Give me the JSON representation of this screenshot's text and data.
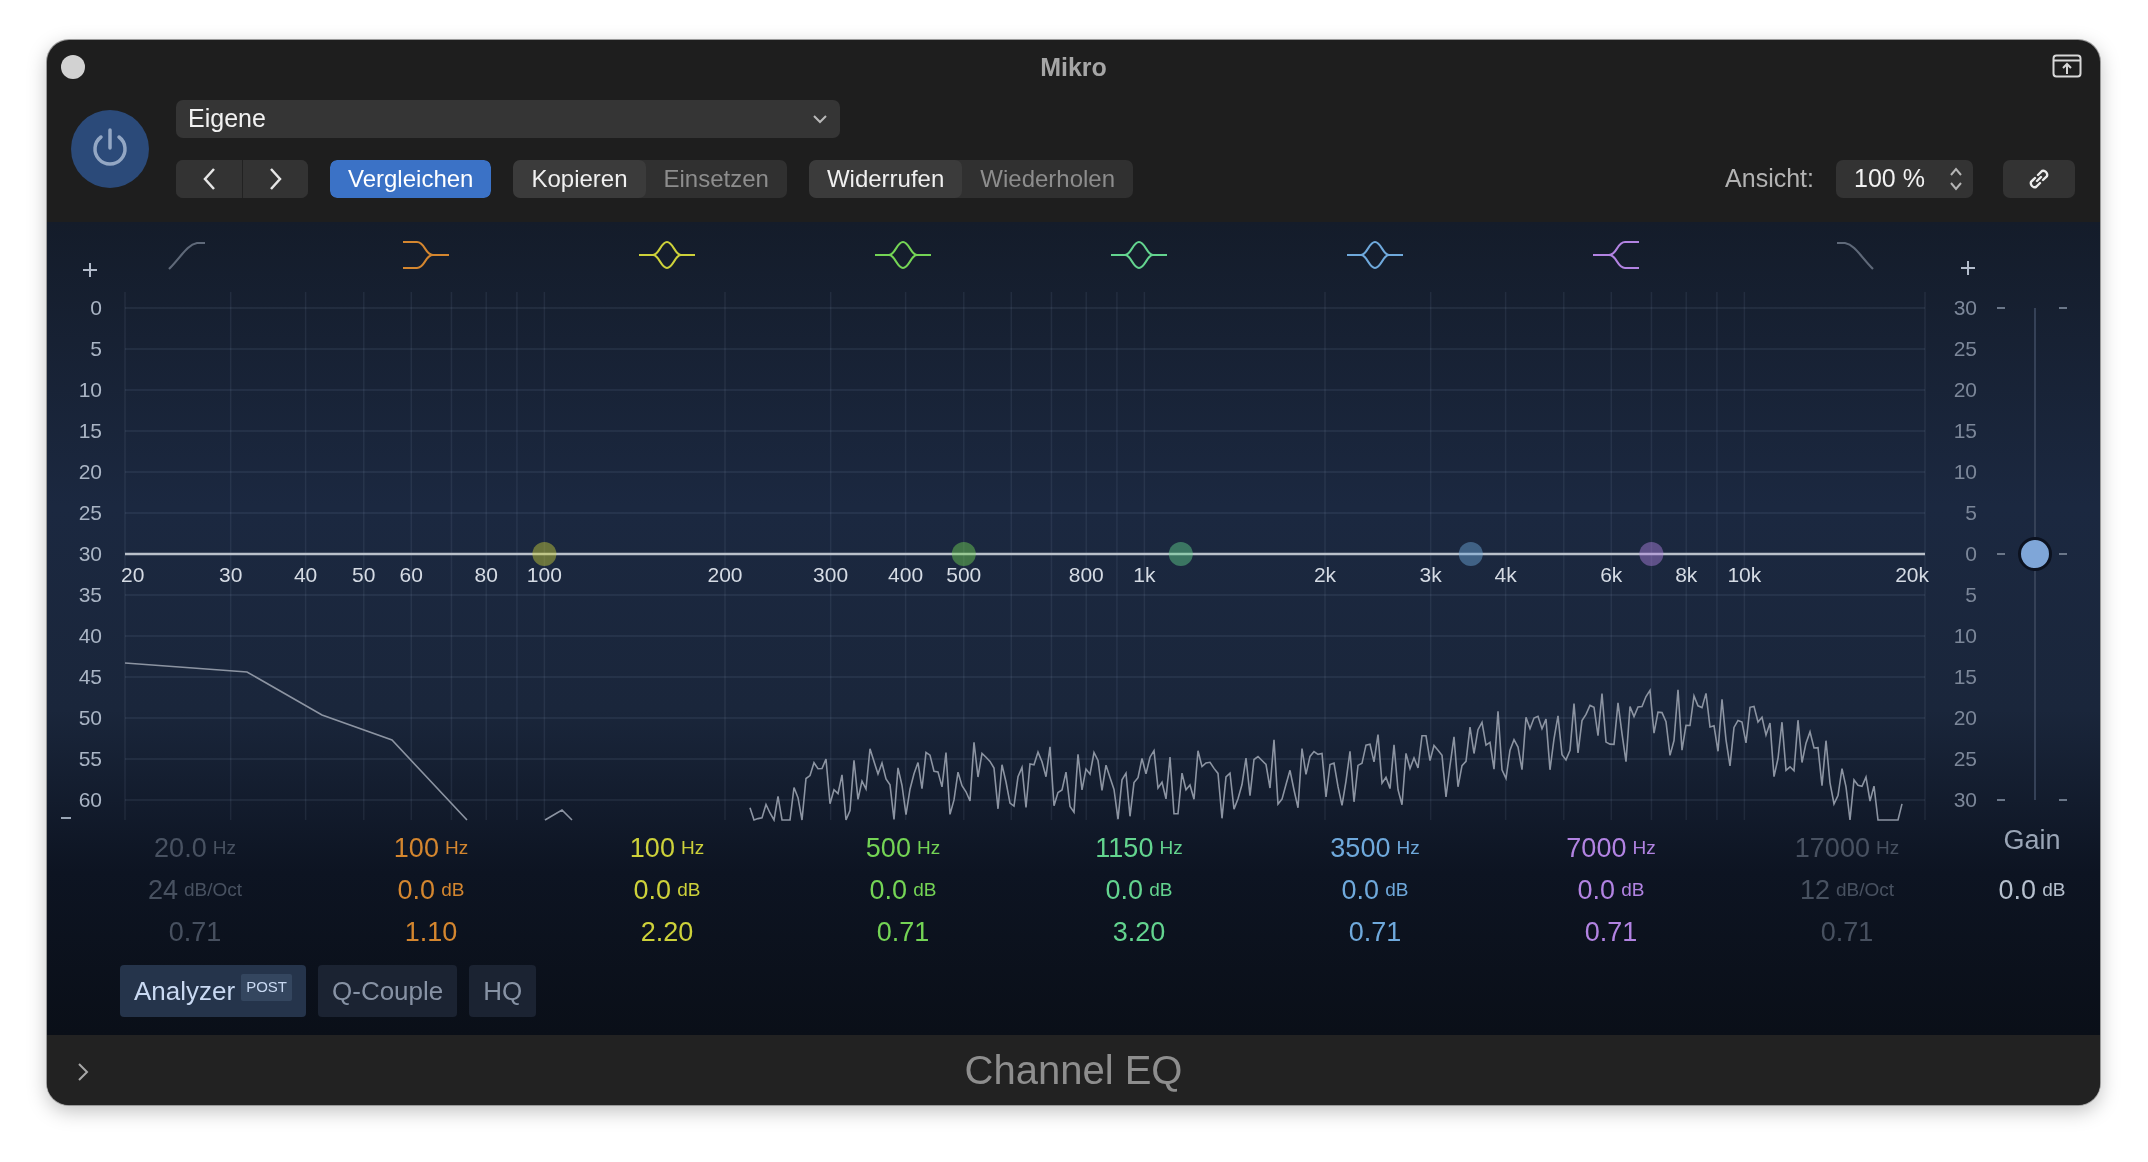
{
  "window": {
    "title": "Mikro"
  },
  "power": {
    "on": true
  },
  "preset": {
    "value": "Eigene"
  },
  "toolbar_groups": [
    {
      "buttons": [
        {
          "label": "Vergleichen",
          "selected": true,
          "disabled": false
        }
      ]
    },
    {
      "buttons": [
        {
          "label": "Kopieren",
          "selected": false,
          "disabled": false
        },
        {
          "label": "Einsetzen",
          "selected": false,
          "disabled": true
        }
      ]
    },
    {
      "buttons": [
        {
          "label": "Widerrufen",
          "selected": false,
          "disabled": false
        },
        {
          "label": "Wiederholen",
          "selected": false,
          "disabled": true
        }
      ]
    }
  ],
  "view": {
    "label": "Ansicht:",
    "value": "100 %"
  },
  "analyzer_axis": [
    "0",
    "5",
    "10",
    "15",
    "20",
    "25",
    "30",
    "35",
    "40",
    "45",
    "50",
    "55",
    "60"
  ],
  "gain_axis": [
    "30",
    "25",
    "20",
    "15",
    "10",
    "5",
    "0",
    "5",
    "10",
    "15",
    "20",
    "25",
    "30"
  ],
  "freq_axis": [
    "20",
    "30",
    "40",
    "50",
    "60",
    "80",
    "100",
    "200",
    "300",
    "400",
    "500",
    "800",
    "1k",
    "2k",
    "3k",
    "4k",
    "6k",
    "8k",
    "10k",
    "20k"
  ],
  "bands": [
    {
      "kind": "low_cut",
      "enabled": false,
      "color": "#5f6979",
      "freq": "20.0",
      "freq_unit": "Hz",
      "gain": "24",
      "gain_unit": "dB/Oct",
      "q": "0.71"
    },
    {
      "kind": "low_shelf",
      "enabled": true,
      "color": "#d4862f",
      "freq": "100",
      "freq_unit": "Hz",
      "gain": "0.0",
      "gain_unit": "dB",
      "q": "1.10"
    },
    {
      "kind": "bell",
      "enabled": true,
      "color": "#cdd13a",
      "freq": "100",
      "freq_unit": "Hz",
      "gain": "0.0",
      "gain_unit": "dB",
      "q": "2.20"
    },
    {
      "kind": "bell",
      "enabled": true,
      "color": "#74d455",
      "freq": "500",
      "freq_unit": "Hz",
      "gain": "0.0",
      "gain_unit": "dB",
      "q": "0.71"
    },
    {
      "kind": "bell",
      "enabled": true,
      "color": "#63d48f",
      "freq": "1150",
      "freq_unit": "Hz",
      "gain": "0.0",
      "gain_unit": "dB",
      "q": "3.20"
    },
    {
      "kind": "bell",
      "enabled": true,
      "color": "#6fa9dc",
      "freq": "3500",
      "freq_unit": "Hz",
      "gain": "0.0",
      "gain_unit": "dB",
      "q": "0.71"
    },
    {
      "kind": "high_shelf",
      "enabled": true,
      "color": "#b283e2",
      "freq": "7000",
      "freq_unit": "Hz",
      "gain": "0.0",
      "gain_unit": "dB",
      "q": "0.71"
    },
    {
      "kind": "high_cut",
      "enabled": false,
      "color": "#5f6979",
      "freq": "17000",
      "freq_unit": "Hz",
      "gain": "12",
      "gain_unit": "dB/Oct",
      "q": "0.71"
    }
  ],
  "gain": {
    "label": "Gain",
    "value": "0.0",
    "unit": "dB",
    "level": 0.5
  },
  "options": [
    {
      "label": "Analyzer",
      "tag": "POST",
      "on": true
    },
    {
      "label": "Q-Couple",
      "on": false
    },
    {
      "label": "HQ",
      "on": false
    }
  ],
  "footer": {
    "title": "Channel EQ"
  }
}
